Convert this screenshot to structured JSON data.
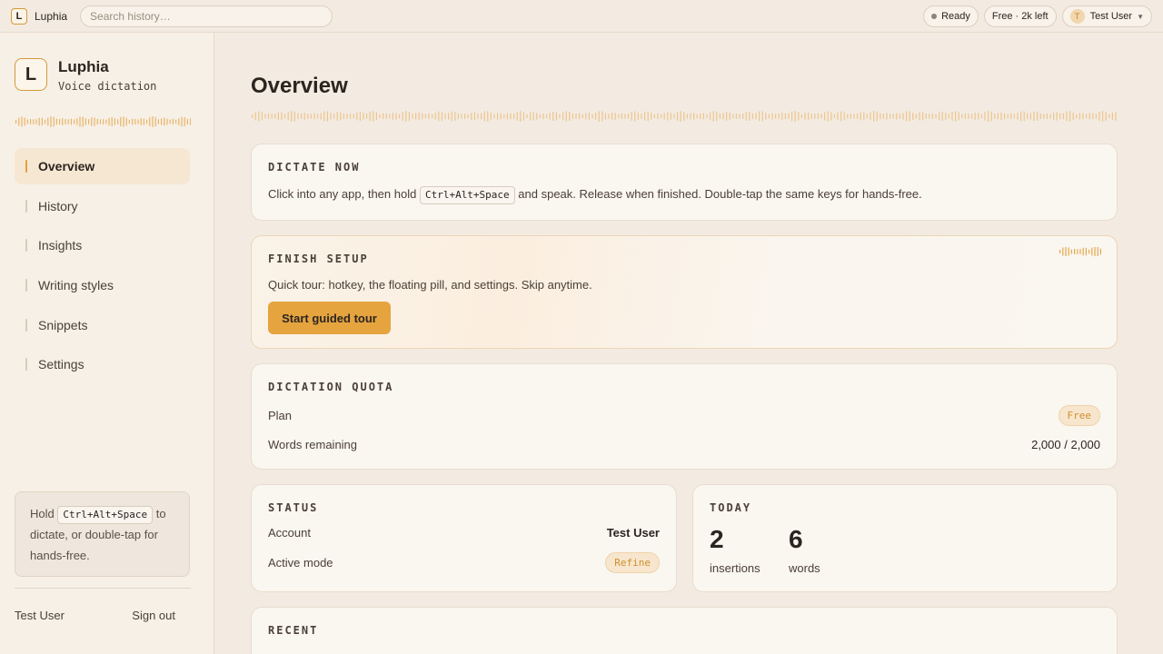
{
  "topbar": {
    "logo_letter": "L",
    "app_name": "Luphia",
    "search_placeholder": "Search history…",
    "status": "Ready",
    "plan_chip": "Free · 2k left",
    "avatar_letter": "T",
    "user": "Test User"
  },
  "sidebar": {
    "logo_letter": "L",
    "brand": "Luphia",
    "subtitle": "Voice dictation",
    "nav": [
      {
        "label": "Overview",
        "active": true
      },
      {
        "label": "History"
      },
      {
        "label": "Insights"
      },
      {
        "label": "Writing styles"
      },
      {
        "label": "Snippets"
      },
      {
        "label": "Settings"
      }
    ],
    "hint": {
      "before": "Hold",
      "key": "Ctrl+Alt+Space",
      "after": "to dictate, or double-tap for hands-free."
    },
    "user": "Test User",
    "sign_out": "Sign out"
  },
  "main": {
    "title": "Overview",
    "dictate": {
      "label": "DICTATE NOW",
      "text_before": "Click into any app, then hold",
      "key": "Ctrl+Alt+Space",
      "text_after": "and speak. Release when finished. Double-tap the same keys for hands-free."
    },
    "setup": {
      "label": "FINISH SETUP",
      "text": "Quick tour: hotkey, the floating pill, and settings. Skip anytime.",
      "button": "Start guided tour"
    },
    "quota": {
      "label": "DICTATION QUOTA",
      "plan_label": "Plan",
      "plan_value": "Free",
      "words_label": "Words remaining",
      "words_value": "2,000 / 2,000"
    },
    "status": {
      "label": "STATUS",
      "account_label": "Account",
      "account_value": "Test User",
      "mode_label": "Active mode",
      "mode_value": "Refine"
    },
    "today": {
      "label": "TODAY",
      "insertions": "2",
      "insertions_label": "insertions",
      "words": "6",
      "words_label": "words"
    },
    "recent": {
      "label": "RECENT"
    }
  },
  "colors": {
    "accent": "#e6a43f",
    "background": "#f3ebe1",
    "card": "#faf6f0"
  }
}
